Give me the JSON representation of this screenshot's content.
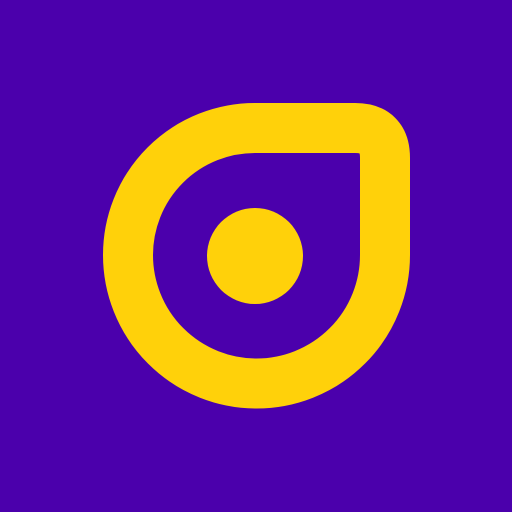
{
  "icon": {
    "semantic_name": "teardrop-eye-logo-icon",
    "colors": {
      "background": "#4B00AC",
      "accent": "#FFD10A"
    }
  }
}
